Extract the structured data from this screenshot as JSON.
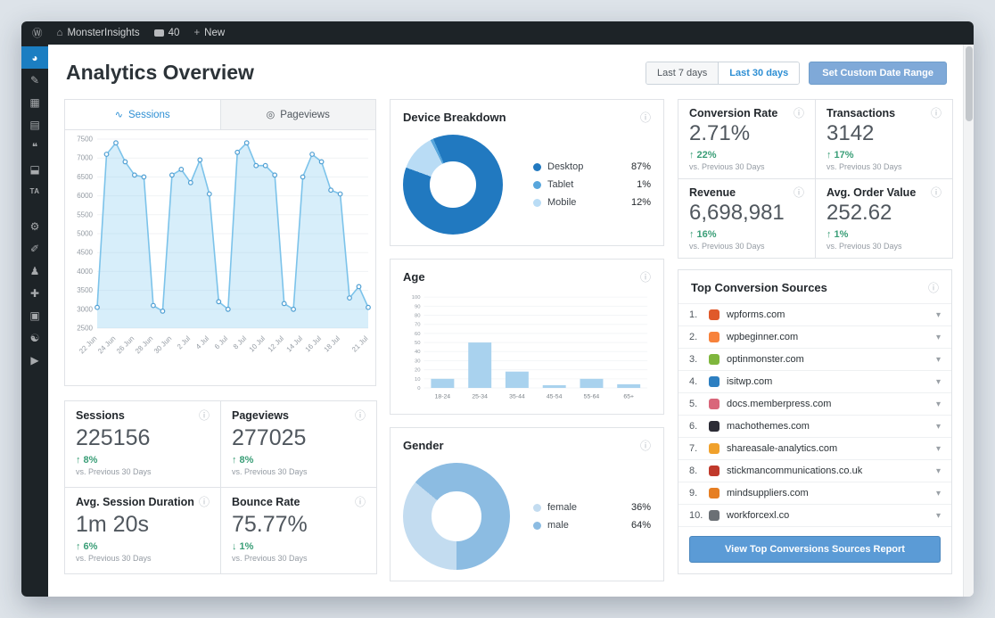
{
  "admin_bar": {
    "site_name": "MonsterInsights",
    "comments_count": "40",
    "new_label": "New"
  },
  "icons": {
    "info": "ⓘ",
    "chevron": "▾",
    "wp": "Ⓦ",
    "home": "⌂",
    "plus": "+",
    "sessions": "∿",
    "pageviews": "◎"
  },
  "sidebar": {
    "items": [
      {
        "name": "monsterinsights",
        "glyph": "◕",
        "active": true
      },
      {
        "name": "posts",
        "glyph": "✎"
      },
      {
        "name": "media",
        "glyph": "▦"
      },
      {
        "name": "pages",
        "glyph": "▤"
      },
      {
        "name": "comments",
        "glyph": "❝"
      },
      {
        "name": "downloads",
        "glyph": "⬓"
      },
      {
        "name": "ta-plugin",
        "glyph": "TA"
      },
      {
        "name": "spacer",
        "spacer": true
      },
      {
        "name": "tools",
        "glyph": "⚙"
      },
      {
        "name": "marketing",
        "glyph": "✐"
      },
      {
        "name": "users",
        "glyph": "♟"
      },
      {
        "name": "plugins",
        "glyph": "✚"
      },
      {
        "name": "forms",
        "glyph": "▣"
      },
      {
        "name": "seo",
        "glyph": "☯"
      },
      {
        "name": "video",
        "glyph": "▶"
      }
    ]
  },
  "header": {
    "title": "Analytics Overview",
    "last7": "Last 7 days",
    "last30": "Last 30 days",
    "custom_range": "Set Custom Date Range"
  },
  "tabs": {
    "sessions": "Sessions",
    "pageviews": "Pageviews"
  },
  "chart_data": [
    {
      "type": "area",
      "title": "Sessions",
      "ylabel": "Sessions",
      "ylim": [
        2500,
        7500
      ],
      "ystep": 500,
      "values": [
        3050,
        7100,
        7400,
        6900,
        6550,
        6500,
        3100,
        2950,
        6550,
        6700,
        6350,
        6950,
        6050,
        3200,
        3000,
        7150,
        7400,
        6800,
        6800,
        6550,
        3150,
        3000,
        6500,
        7100,
        6900,
        6150,
        6050,
        3300,
        3600,
        3050
      ],
      "tick_labels": [
        "22 Jun",
        "24 Jun",
        "26 Jun",
        "28 Jun",
        "30 Jun",
        "2 Jul",
        "4 Jul",
        "6 Jul",
        "8 Jul",
        "10 Jul",
        "12 Jul",
        "14 Jul",
        "16 Jul",
        "18 Jul",
        "21 Jul"
      ],
      "tick_indices": [
        0,
        2,
        4,
        6,
        8,
        10,
        12,
        14,
        16,
        18,
        20,
        22,
        24,
        26,
        29
      ],
      "line_color": "#7cc3ea",
      "fill_color": "rgba(141,205,241,0.35)",
      "point_color": "#4f9fd3"
    },
    {
      "type": "pie",
      "title": "Device Breakdown",
      "labels": [
        "Desktop",
        "Tablet",
        "Mobile"
      ],
      "values": [
        87,
        1,
        12
      ],
      "colors": [
        "#2179c0",
        "#58a6dc",
        "#b9dcf5"
      ],
      "legend": [
        {
          "label": "Desktop",
          "value": "87%"
        },
        {
          "label": "Tablet",
          "value": "1%"
        },
        {
          "label": "Mobile",
          "value": "12%"
        }
      ]
    },
    {
      "type": "bar",
      "title": "Age",
      "categories": [
        "18-24",
        "25-34",
        "35-44",
        "45-54",
        "55-64",
        "65+"
      ],
      "values": [
        10,
        50,
        18,
        3,
        10,
        4
      ],
      "ylim": [
        0,
        100
      ],
      "ystep": 10,
      "bar_color": "#a9d2ee"
    },
    {
      "type": "pie",
      "title": "Gender",
      "labels": [
        "female",
        "male"
      ],
      "values": [
        36,
        64
      ],
      "colors": [
        "#c3dcf0",
        "#8cbce2"
      ],
      "legend": [
        {
          "label": "female",
          "value": "36%"
        },
        {
          "label": "male",
          "value": "64%"
        }
      ]
    }
  ],
  "stats": [
    {
      "label": "Sessions",
      "value": "225156",
      "delta": "↑ 8%",
      "compare": "vs. Previous 30 Days"
    },
    {
      "label": "Pageviews",
      "value": "277025",
      "delta": "↑ 8%",
      "compare": "vs. Previous 30 Days"
    },
    {
      "label": "Avg. Session Duration",
      "value": "1m 20s",
      "delta": "↑ 6%",
      "compare": "vs. Previous 30 Days"
    },
    {
      "label": "Bounce Rate",
      "value": "75.77%",
      "delta": "↓ 1%",
      "compare": "vs. Previous 30 Days"
    }
  ],
  "ecommerce": [
    {
      "label": "Conversion Rate",
      "value": "2.71%",
      "delta": "↑ 22%",
      "compare": "vs. Previous 30 Days"
    },
    {
      "label": "Transactions",
      "value": "3142",
      "delta": "↑ 17%",
      "compare": "vs. Previous 30 Days"
    },
    {
      "label": "Revenue",
      "value": "6,698,981",
      "delta": "↑ 16%",
      "compare": "vs. Previous 30 Days"
    },
    {
      "label": "Avg. Order Value",
      "value": "252.62",
      "delta": "↑ 1%",
      "compare": "vs. Previous 30 Days"
    }
  ],
  "top_sources": {
    "title": "Top Conversion Sources",
    "button_label": "View Top Conversions Sources Report",
    "items": [
      {
        "rank": "1.",
        "domain": "wpforms.com",
        "favicon_color": "#e0592a"
      },
      {
        "rank": "2.",
        "domain": "wpbeginner.com",
        "favicon_color": "#f7823b"
      },
      {
        "rank": "3.",
        "domain": "optinmonster.com",
        "favicon_color": "#7fb63d"
      },
      {
        "rank": "4.",
        "domain": "isitwp.com",
        "favicon_color": "#2d7fc1"
      },
      {
        "rank": "5.",
        "domain": "docs.memberpress.com",
        "favicon_color": "#d9667a"
      },
      {
        "rank": "6.",
        "domain": "machothemes.com",
        "favicon_color": "#2b2b35"
      },
      {
        "rank": "7.",
        "domain": "shareasale-analytics.com",
        "favicon_color": "#f0a12c"
      },
      {
        "rank": "8.",
        "domain": "stickmancommunications.co.uk",
        "favicon_color": "#c0392b"
      },
      {
        "rank": "9.",
        "domain": "mindsuppliers.com",
        "favicon_color": "#e67e22"
      },
      {
        "rank": "10.",
        "domain": "workforcexl.co",
        "favicon_color": "#6b7075"
      }
    ]
  }
}
